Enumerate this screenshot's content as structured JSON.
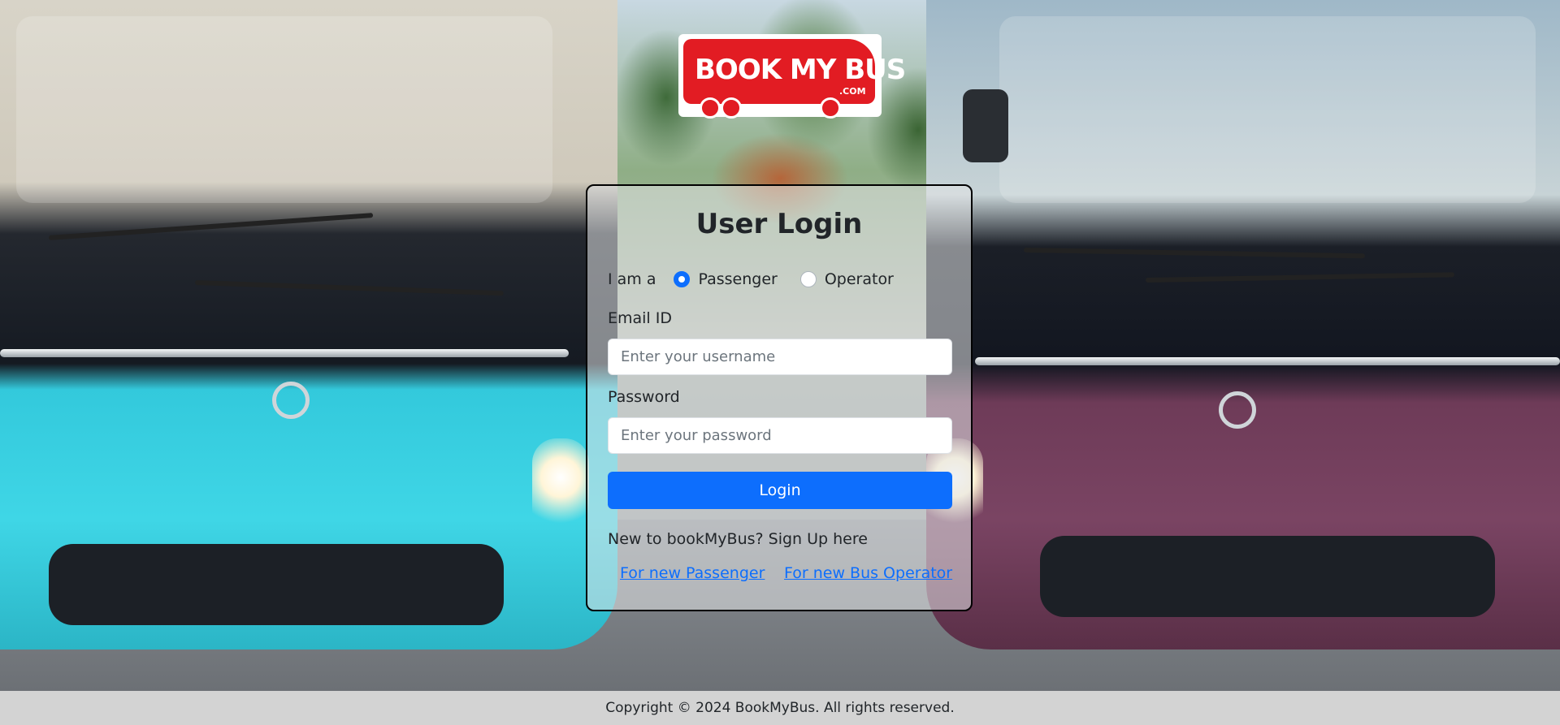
{
  "brand": {
    "logo_text": "BOOK MY BUS",
    "logo_sub": ".COM",
    "brand_color": "#e21c23"
  },
  "login": {
    "title": "User Login",
    "role_label": "I am a",
    "roles": [
      {
        "label": "Passenger",
        "selected": true
      },
      {
        "label": "Operator",
        "selected": false
      }
    ],
    "email_label": "Email ID",
    "email_placeholder": "Enter your username",
    "password_label": "Password",
    "password_placeholder": "Enter your password",
    "submit_label": "Login",
    "signup_prompt": "New to bookMyBus? Sign Up here",
    "signup_links": [
      {
        "label": "For new Passenger"
      },
      {
        "label": "For new Bus Operator"
      }
    ],
    "accent_color": "#0d6efd"
  },
  "footer": {
    "copyright": "Copyright © 2024 BookMyBus. All rights reserved."
  }
}
